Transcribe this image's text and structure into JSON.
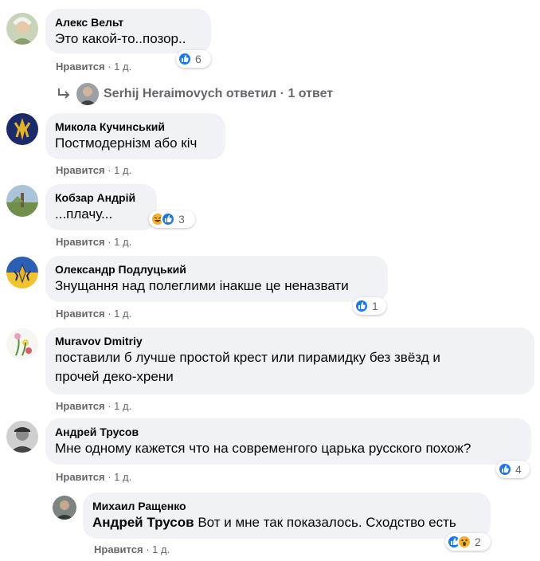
{
  "like_label": "Нравится",
  "comments": [
    {
      "author": "Алекс Вельт",
      "text": "Это какой-то..позор..",
      "time": "1 д.",
      "reaction_count": "6"
    },
    {
      "author": "Микола Кучинський",
      "text": "Постмодернізм або кіч",
      "time": "1 д."
    },
    {
      "author": "Кобзар Андрій",
      "text": "...плачу...",
      "time": "1 д.",
      "reaction_count": "3"
    },
    {
      "author": "Олександр Подлуцький",
      "text": "Знущання над полеглими інакше це неназвати",
      "time": "1 д.",
      "reaction_count": "1"
    },
    {
      "author": "Muravov Dmitriy",
      "text_line1": "поставили б лучше простой крест или пирамидку без звёзд и",
      "text_line2": "прочей деко-хрени",
      "time": "1 д."
    },
    {
      "author": "Андрей Трусов",
      "text": "Мне одному кажется что на современгого царька русского похож?",
      "time": "1 д.",
      "reaction_count": "4"
    }
  ],
  "reply_thread": {
    "replier": "Serhij Heraimovych",
    "replied_label": "ответил",
    "count_label": "1 ответ"
  },
  "nested_reply": {
    "author": "Михаил Ращенко",
    "mention": "Андрей Трусов",
    "text": "Вот и мне так показалось. Сходство есть",
    "time": "1 д.",
    "reaction_count": "2"
  },
  "colors": {
    "bubble": "#f0f2f5",
    "like_blue": "#1877f2",
    "emoji_yellow": "#f7b125",
    "secondary_text": "#65676b"
  }
}
